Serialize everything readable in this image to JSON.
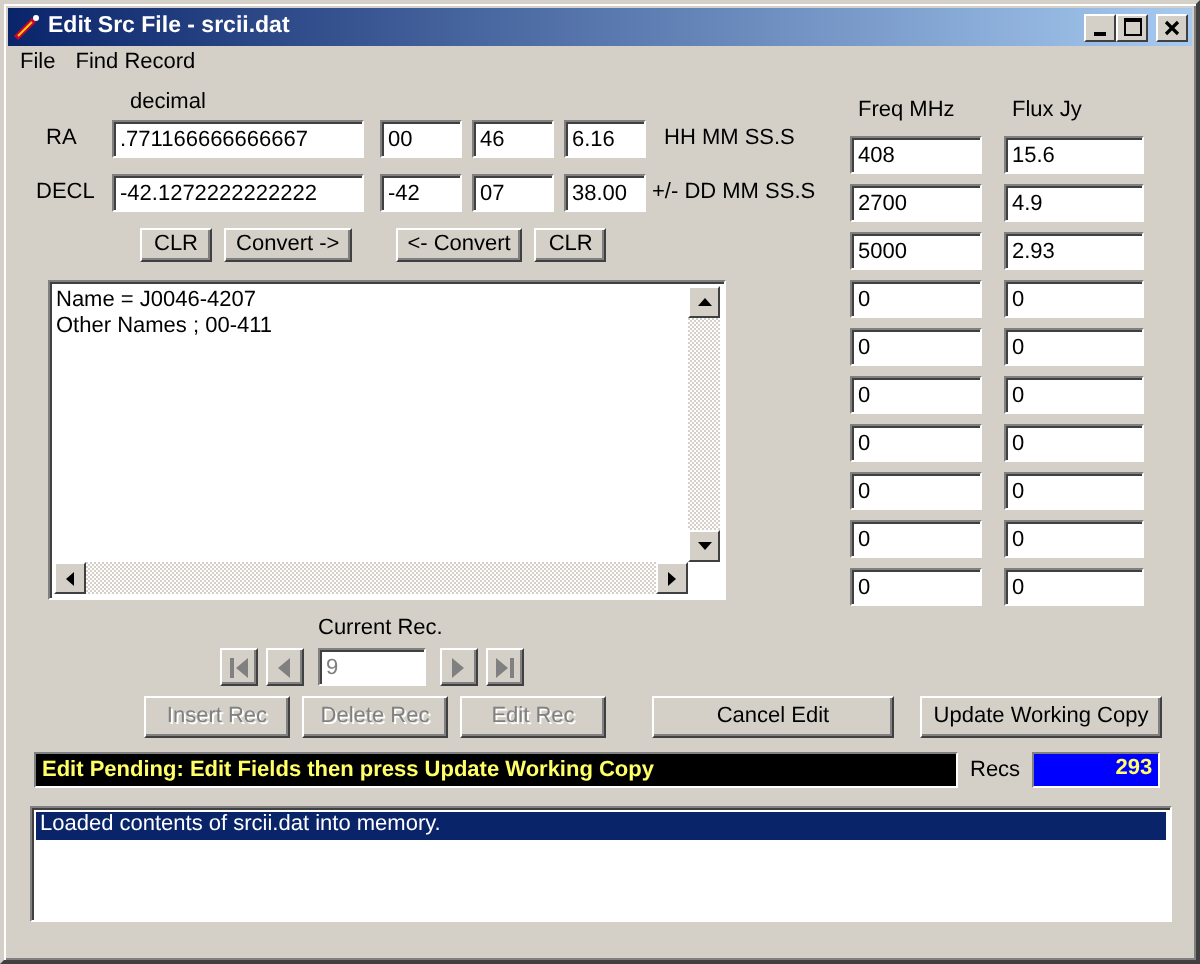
{
  "window": {
    "title": "Edit Src File - srcii.dat"
  },
  "menu": [
    {
      "label": "File"
    },
    {
      "label": "Find Record"
    }
  ],
  "coordinates": {
    "header": "decimal",
    "rows": [
      {
        "label": "RA",
        "decimal": ".771166666666667",
        "parts": [
          "00",
          "46",
          "6.16"
        ],
        "format": "HH MM SS.S"
      },
      {
        "label": "DECL",
        "decimal": "-42.1272222222222",
        "parts": [
          "-42",
          "07",
          "38.00"
        ],
        "format": "+/- DD MM SS.S"
      }
    ]
  },
  "convert_buttons": [
    {
      "label": "CLR"
    },
    {
      "label": "Convert ->"
    },
    {
      "label": "<- Convert"
    },
    {
      "label": "CLR"
    }
  ],
  "notes": [
    "Name = J0046-4207",
    "Other Names ; 00-411"
  ],
  "spectrum": {
    "columns": [
      "Freq MHz",
      "Flux Jy"
    ],
    "rows": [
      [
        "408",
        "15.6"
      ],
      [
        "2700",
        "4.9"
      ],
      [
        "5000",
        "2.93"
      ],
      [
        "0",
        "0"
      ],
      [
        "0",
        "0"
      ],
      [
        "0",
        "0"
      ],
      [
        "0",
        "0"
      ],
      [
        "0",
        "0"
      ],
      [
        "0",
        "0"
      ],
      [
        "0",
        "0"
      ]
    ]
  },
  "navigation": {
    "label": "Current Rec.",
    "value": "9",
    "disabled": true,
    "buttons": [
      {
        "kind": "first",
        "disabled": true
      },
      {
        "kind": "prev",
        "disabled": true
      },
      {
        "kind": "next",
        "disabled": true
      },
      {
        "kind": "last",
        "disabled": true
      }
    ]
  },
  "record_buttons": [
    {
      "label": "Insert Rec",
      "disabled": true
    },
    {
      "label": "Delete Rec",
      "disabled": true
    },
    {
      "label": "Edit Rec",
      "disabled": true
    },
    {
      "label": "Cancel Edit",
      "disabled": false
    },
    {
      "label": "Update Working Copy",
      "disabled": false
    }
  ],
  "status": "Edit Pending: Edit Fields then press Update Working Copy",
  "recs": {
    "label": "Recs",
    "value": "293"
  },
  "log": [
    {
      "text": "Loaded contents of srcii.dat into memory.",
      "selected": true
    }
  ]
}
